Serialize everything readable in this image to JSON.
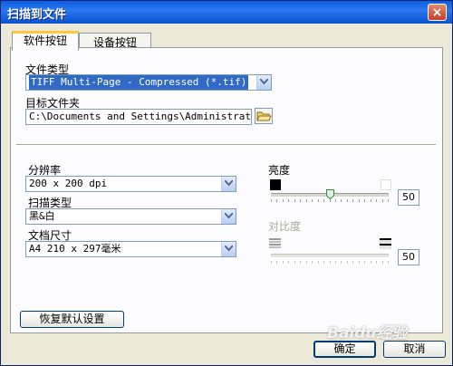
{
  "window": {
    "title": "扫描到文件",
    "close_symbol": "×"
  },
  "tabs": [
    {
      "label": "软件按钮",
      "active": true
    },
    {
      "label": "设备按钮",
      "active": false
    }
  ],
  "file_type": {
    "label": "文件类型",
    "value": "TIFF Multi-Page - Compressed (*.tif)"
  },
  "target_folder": {
    "label": "目标文件夹",
    "value": "C:\\Documents and Settings\\Administrator\\桌面"
  },
  "resolution": {
    "label": "分辨率",
    "value": "200 x 200 dpi"
  },
  "scan_type": {
    "label": "扫描类型",
    "value": "黑&白"
  },
  "doc_size": {
    "label": "文档尺寸",
    "value": "A4 210 x 297毫米"
  },
  "brightness": {
    "label": "亮度",
    "value": "50",
    "level_percent": 50
  },
  "contrast": {
    "label": "对比度",
    "value": "50",
    "level_percent": 50,
    "enabled": false
  },
  "restore_defaults": {
    "label": "恢复默认设置"
  },
  "ok": {
    "label": "确定"
  },
  "cancel": {
    "label": "取消"
  },
  "watermark": {
    "text": "Baidu经验"
  }
}
